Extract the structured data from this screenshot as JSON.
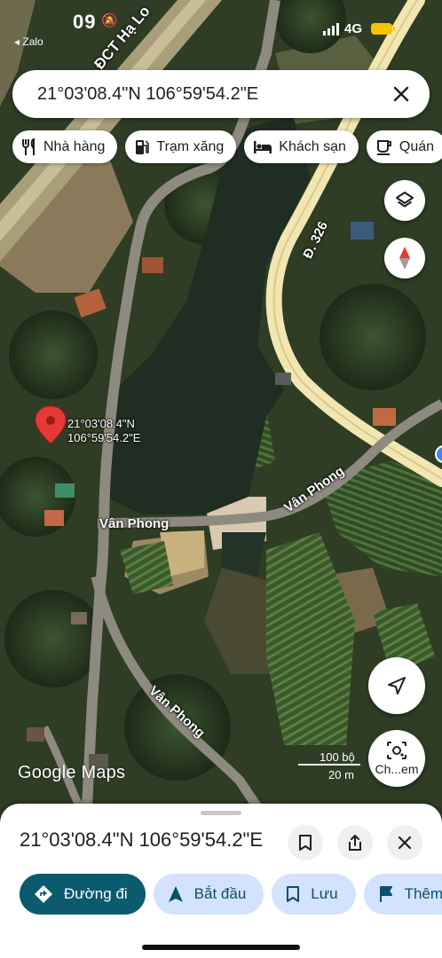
{
  "status_bar": {
    "time": "09",
    "back_app": "◂ Zalo",
    "network": "4G",
    "colors": {
      "battery": "#f5c400"
    }
  },
  "search": {
    "value": "21°03'08.4\"N 106°59'54.2\"E",
    "clear_icon": "close-icon"
  },
  "chips": [
    {
      "label": "Nhà hàng",
      "icon": "restaurant-icon"
    },
    {
      "label": "Trạm xăng",
      "icon": "gas-station-icon"
    },
    {
      "label": "Khách sạn",
      "icon": "hotel-icon"
    },
    {
      "label": "Quán",
      "icon": "cafe-icon"
    }
  ],
  "map": {
    "type": "satellite",
    "pin_label_line1": "21°03'08.4\"N",
    "pin_label_line2": "106°59'54.2\"E",
    "road_labels": {
      "highway": "ĐCT Hạ Lo",
      "provincial": "Đ. 326",
      "van_phong_1": "Vân Phong",
      "van_phong_2": "Vân Phong",
      "van_phong_3": "Vân Phong"
    },
    "scale_top": "100 bộ",
    "scale_bottom": "20 m",
    "logo": "Google Maps",
    "lens_label": "Ch...em",
    "colors": {
      "pin": "#e53935",
      "road": "#f2e6b2",
      "water": "#1f2d22"
    }
  },
  "place_sheet": {
    "title": "21°03'08.4\"N 106°59'54.2\"E",
    "actions": [
      {
        "label": "Đường đi",
        "icon": "directions-icon",
        "primary": true
      },
      {
        "label": "Bắt đầu",
        "icon": "navigation-arrow-icon"
      },
      {
        "label": "Lưu",
        "icon": "bookmark-icon"
      },
      {
        "label": "Thêm",
        "icon": "flag-icon"
      }
    ],
    "colors": {
      "primary": "#0b5a6e",
      "secondary": "#d3e3fd"
    }
  }
}
